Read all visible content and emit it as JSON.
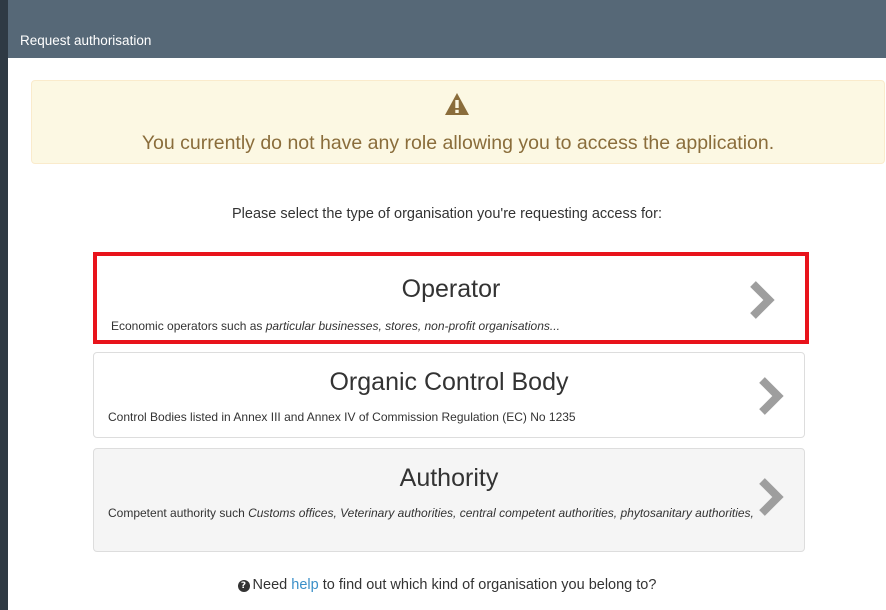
{
  "header": {
    "title": "Request authorisation"
  },
  "warning": {
    "icon": "warning-icon",
    "message": "You currently do not have any role allowing you to access the application."
  },
  "instruction": "Please select the type of organisation you're requesting access for:",
  "options": [
    {
      "title": "Operator",
      "desc_plain": "Economic operators such as ",
      "desc_italic": "particular businesses, stores, non-profit organisations...",
      "selected": true
    },
    {
      "title": "Organic Control Body",
      "desc_plain": "Control Bodies listed in Annex III and Annex IV of Commission Regulation (EC) No 1235",
      "desc_italic": ""
    },
    {
      "title": "Authority",
      "desc_plain": "Competent authority such ",
      "desc_italic": "Customs offices, Veterinary authorities, central competent authorities, phytosanitary authorities,"
    }
  ],
  "help": {
    "prefix": "Need ",
    "link": "help",
    "suffix": " to find out which kind of organisation you belong to?"
  },
  "colors": {
    "header_bg": "#566877",
    "warning_bg": "#fcf8e3",
    "warning_text": "#8a6d3b",
    "selection_outline": "#e8131b",
    "link": "#3a8fc8"
  }
}
